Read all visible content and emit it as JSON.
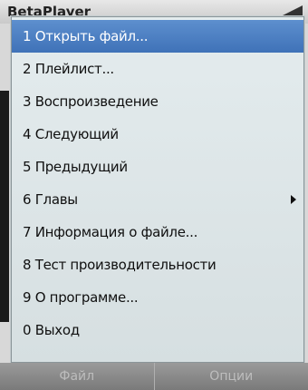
{
  "titlebar": {
    "app_title": "BetaPlayer"
  },
  "menu": {
    "items": [
      {
        "label": "1 Открыть файл...",
        "selected": true
      },
      {
        "label": "2 Плейлист..."
      },
      {
        "label": "3 Воспроизведение"
      },
      {
        "label": "4 Следующий"
      },
      {
        "label": "5 Предыдущий"
      },
      {
        "label": "6 Главы",
        "submenu": true
      },
      {
        "label": "7 Информация о файле..."
      },
      {
        "label": "8 Тест производительности"
      },
      {
        "label": "9 О программе..."
      },
      {
        "label": "0 Выход"
      }
    ]
  },
  "softkeys": {
    "left": "Файл",
    "right": "Опции"
  },
  "colors": {
    "selection": "#4a7ec4",
    "menu_bg": "#dfe7e9"
  }
}
